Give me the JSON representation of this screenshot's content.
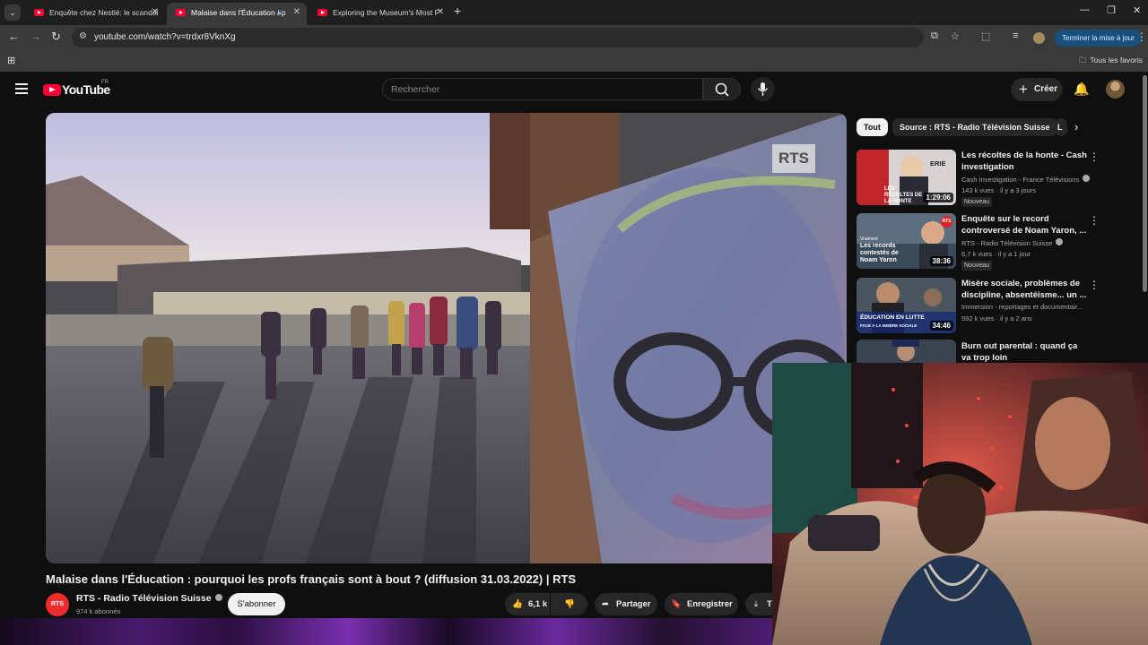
{
  "tabs": [
    {
      "title": "Enquête chez Nestlé: le scandal"
    },
    {
      "title": "Malaise dans l'Éducation : p"
    },
    {
      "title": "Exploring the Museum's Most F"
    }
  ],
  "browser": {
    "url": "youtube.com/watch?v=trdxr8VknXg",
    "update_label": "Terminer la mise à jour",
    "favorites_label": "Tous les favoris"
  },
  "youtube": {
    "logo_text": "YouTube",
    "region": "FR",
    "search_placeholder": "Rechercher",
    "create_label": "Créer"
  },
  "video": {
    "watermark": "RTS",
    "title": "Malaise dans l'Éducation : pourquoi les profs français sont à bout ? (diffusion 31.03.2022) | RTS",
    "channel_logo": "RTS",
    "channel": "RTS - Radio Télévision Suisse",
    "subscribers": "974 k abonnés",
    "subscribe_label": "S'abonner",
    "likes": "6,1 k",
    "share_label": "Partager",
    "save_label": "Enregistrer",
    "download_label": "Té"
  },
  "chips": [
    {
      "label": "Tout",
      "selected": true
    },
    {
      "label": "Source : RTS - Radio Télévision Suisse"
    },
    {
      "label": "L"
    }
  ],
  "recommendations": [
    {
      "title": "Les récoltes de la honte - Cash investigation",
      "channel": "Cash Investigation - France Télévisions",
      "meta": "143 k vues · il y a 3 jours",
      "badge": "Nouveau",
      "duration": "1:29:06",
      "thumb_caption": "LES RÉCOLTES DE LA HONTE",
      "thumb_corner": "ERIE"
    },
    {
      "title": "Enquête sur le record controversé de Noam Yaron, ...",
      "channel": "RTS - Radio Télévision Suisse",
      "meta": "6,7 k vues · il y a 1 jour",
      "badge": "Nouveau",
      "duration": "38:36",
      "thumb_caption": "Les records contestés de Noam Yaron",
      "thumb_small": "Vraiment",
      "thumb_logo": "RTS"
    },
    {
      "title": "Misère sociale, problèmes de discipline, absentéisme... un ...",
      "channel": "Immersion - reportages et documentair...",
      "meta": "592 k vues · il y a 2 ans",
      "duration": "34:46",
      "thumb_caption": "ÉDUCATION EN LUTTE",
      "thumb_sub": "FACE À LA MISÈRE SOCIALE"
    },
    {
      "title": "Burn out parental : quand ça va trop loin"
    }
  ]
}
